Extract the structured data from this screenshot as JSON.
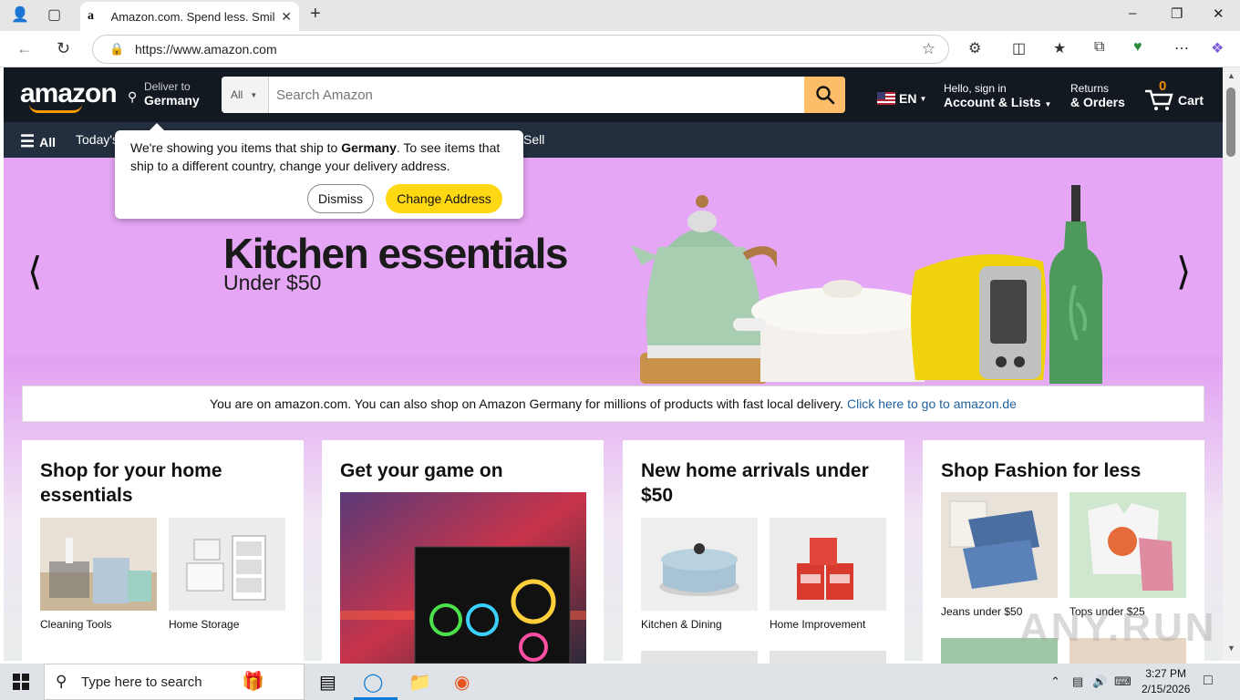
{
  "browser": {
    "tab_title": "Amazon.com. Spend less. Smile more.",
    "tab_favicon": "a",
    "url": "https://www.amazon.com"
  },
  "header": {
    "logo_text": "amazon",
    "deliver_line1": "Deliver to",
    "deliver_line2": "Germany",
    "search_category": "All",
    "search_placeholder": "Search Amazon",
    "language": "EN",
    "account_line1": "Hello, sign in",
    "account_line2": "Account & Lists",
    "orders_line1": "Returns",
    "orders_line2": "& Orders",
    "cart_count": "0",
    "cart_label": "Cart"
  },
  "subnav": {
    "all_label": "All",
    "items": [
      "Today's",
      "Sell"
    ]
  },
  "popover": {
    "text_before": "We're showing you items that ship to ",
    "country": "Germany",
    "text_after": ". To see items that ship to a different country, change your delivery address.",
    "dismiss": "Dismiss",
    "change": "Change Address"
  },
  "hero": {
    "title": "Kitchen essentials",
    "subtitle": "Under $50"
  },
  "infobar": {
    "text": "You are on amazon.com. You can also shop on Amazon Germany for millions of products with fast local delivery.",
    "link": "Click here to go to amazon.de"
  },
  "cards": [
    {
      "title": "Shop for your home essentials",
      "tiles": [
        "Cleaning Tools",
        "Home Storage"
      ]
    },
    {
      "title": "Get your game on",
      "tiles": []
    },
    {
      "title": "New home arrivals under $50",
      "tiles": [
        "Kitchen & Dining",
        "Home Improvement"
      ]
    },
    {
      "title": "Shop Fashion for less",
      "tiles": [
        "Jeans under $50",
        "Tops under $25"
      ]
    }
  ],
  "watermark": "ANY.RUN",
  "taskbar": {
    "search_placeholder": "Type here to search",
    "time": "3:27 PM",
    "date": "2/15/2026"
  },
  "colors": {
    "amazon_dark": "#131921",
    "amazon_subnav": "#232f3e",
    "amazon_orange": "#ff9900",
    "search_button": "#febd69",
    "hero_bg": "#e6a6f6",
    "change_button": "#ffd814",
    "link_blue": "#2162a1"
  }
}
